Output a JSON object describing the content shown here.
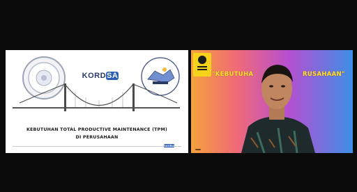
{
  "slide": {
    "brand_prefix": "KORD",
    "brand_accent": "SA",
    "title_line1": "KEBUTUHAN TOTAL PRODUCTIVE MAINTENANCE (TPM)",
    "title_line2": "DI PERUSAHAAN",
    "footer_logo_prefix": "kordsa"
  },
  "video": {
    "banner_left": "\"KEBUTUHA",
    "banner_right": "RUSAHAAN\"",
    "participant_name": ""
  },
  "colors": {
    "background": "#0b0b0b",
    "slide_bg": "#ffffff",
    "brand_blue": "#2a5fb8",
    "banner_yellow": "#ffe234",
    "badge_yellow": "#f7d21a"
  },
  "icons": [
    "tire-illustration",
    "factory-machine-illustration",
    "suspension-bridge-illustration",
    "university-badge-icon"
  ]
}
